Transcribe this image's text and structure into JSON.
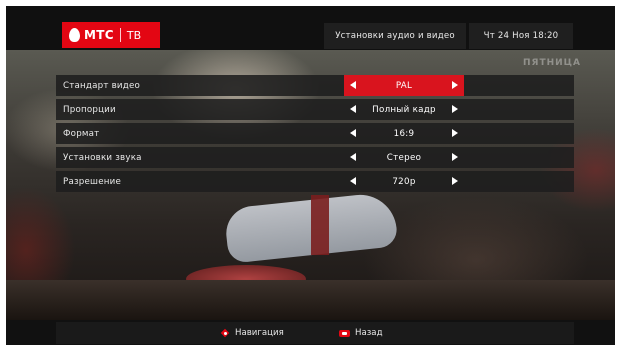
{
  "header": {
    "brand": "МТС",
    "service": "ТВ",
    "title": "Установки аудио и видео",
    "datetime": "Чт 24 Ноя 18:20"
  },
  "video": {
    "channel_watermark": "ПЯТНИЦА"
  },
  "settings": {
    "rows": [
      {
        "label": "Стандарт видео",
        "value": "PAL",
        "active": true
      },
      {
        "label": "Пропорции",
        "value": "Полный кадр",
        "active": false
      },
      {
        "label": "Формат",
        "value": "16:9",
        "active": false
      },
      {
        "label": "Установки звука",
        "value": "Стерео",
        "active": false
      },
      {
        "label": "Разрешение",
        "value": "720p",
        "active": false
      }
    ]
  },
  "footer": {
    "navigation_label": "Навигация",
    "back_label": "Назад"
  },
  "colors": {
    "accent": "#e30613",
    "selection": "#d9141e",
    "row_background": "#1e1e1e",
    "header_background": "#101010"
  },
  "icons": {
    "logo": "mts-egg-logo",
    "navigation": "dpad-icon",
    "back": "back-key-icon",
    "left": "arrow-left-icon",
    "right": "arrow-right-icon"
  }
}
